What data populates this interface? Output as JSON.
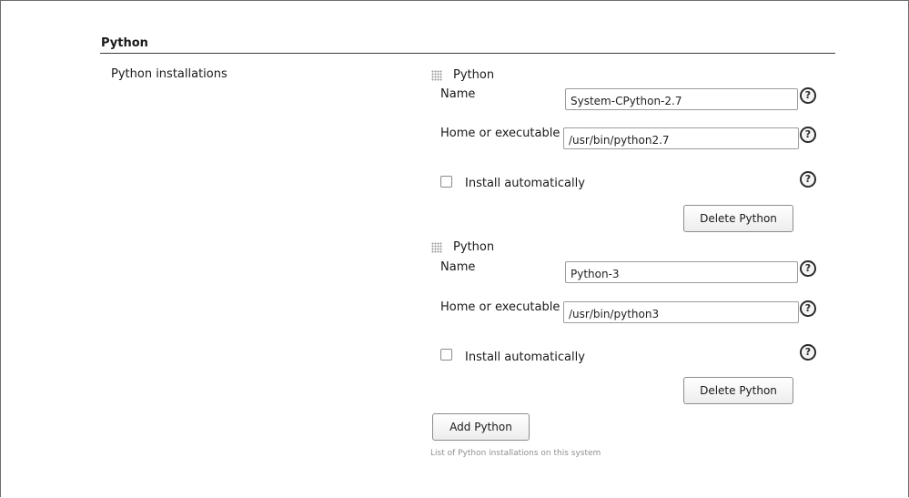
{
  "section": {
    "title": "Python"
  },
  "field": {
    "label": "Python installations"
  },
  "installations": [
    {
      "heading": "Python",
      "name_label": "Name",
      "name_value": "System-CPython-2.7",
      "home_label": "Home or executable",
      "home_value": "/usr/bin/python2.7",
      "install_label": "Install automatically",
      "install_checked": false,
      "delete_label": "Delete Python"
    },
    {
      "heading": "Python",
      "name_label": "Name",
      "name_value": "Python-3",
      "home_label": "Home or executable",
      "home_value": "/usr/bin/python3",
      "install_label": "Install automatically",
      "install_checked": false,
      "delete_label": "Delete Python"
    }
  ],
  "add_button_label": "Add Python",
  "help_text": "List of Python installations on this system",
  "icons": {
    "help": "help-icon",
    "drag": "drag-handle-icon",
    "help_glyph": "?"
  }
}
